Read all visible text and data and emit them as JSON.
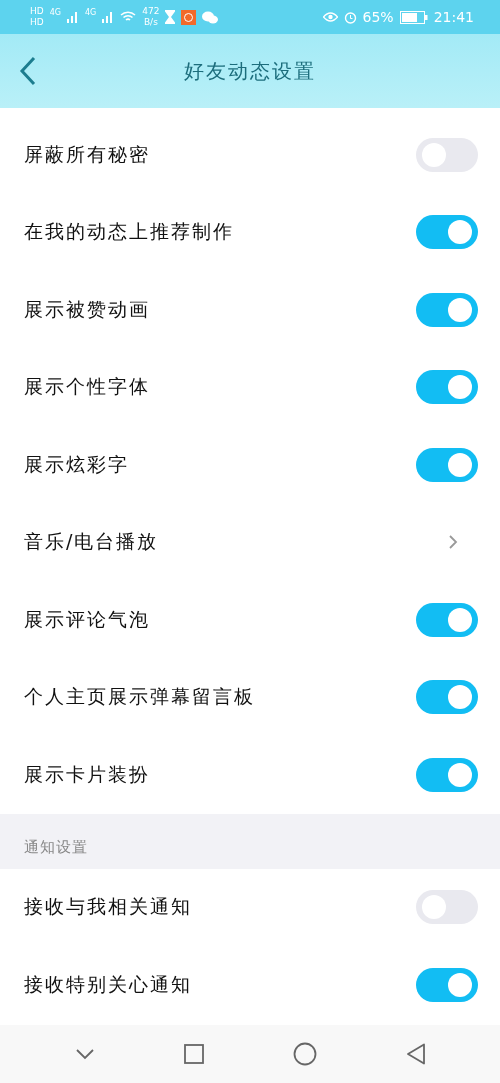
{
  "status_bar": {
    "hd": [
      "HD",
      "HD"
    ],
    "network": [
      "4G",
      "4G"
    ],
    "speed": [
      "472",
      "B/s"
    ],
    "battery": "65%",
    "time": "21:41"
  },
  "header": {
    "title": "好友动态设置"
  },
  "items": [
    {
      "label": "屏蔽所有秘密",
      "kind": "toggle",
      "on": false
    },
    {
      "label": "在我的动态上推荐制作",
      "kind": "toggle",
      "on": true
    },
    {
      "label": "展示被赞动画",
      "kind": "toggle",
      "on": true
    },
    {
      "label": "展示个性字体",
      "kind": "toggle",
      "on": true
    },
    {
      "label": "展示炫彩字",
      "kind": "toggle",
      "on": true
    },
    {
      "label": "音乐/电台播放",
      "kind": "link"
    },
    {
      "label": "展示评论气泡",
      "kind": "toggle",
      "on": true
    },
    {
      "label": "个人主页展示弹幕留言板",
      "kind": "toggle",
      "on": true
    },
    {
      "label": "展示卡片装扮",
      "kind": "toggle",
      "on": true
    }
  ],
  "section": {
    "title": "通知设置",
    "items": [
      {
        "label": "接收与我相关通知",
        "kind": "toggle",
        "on": false
      },
      {
        "label": "接收特别关心通知",
        "kind": "toggle",
        "on": true
      }
    ]
  }
}
